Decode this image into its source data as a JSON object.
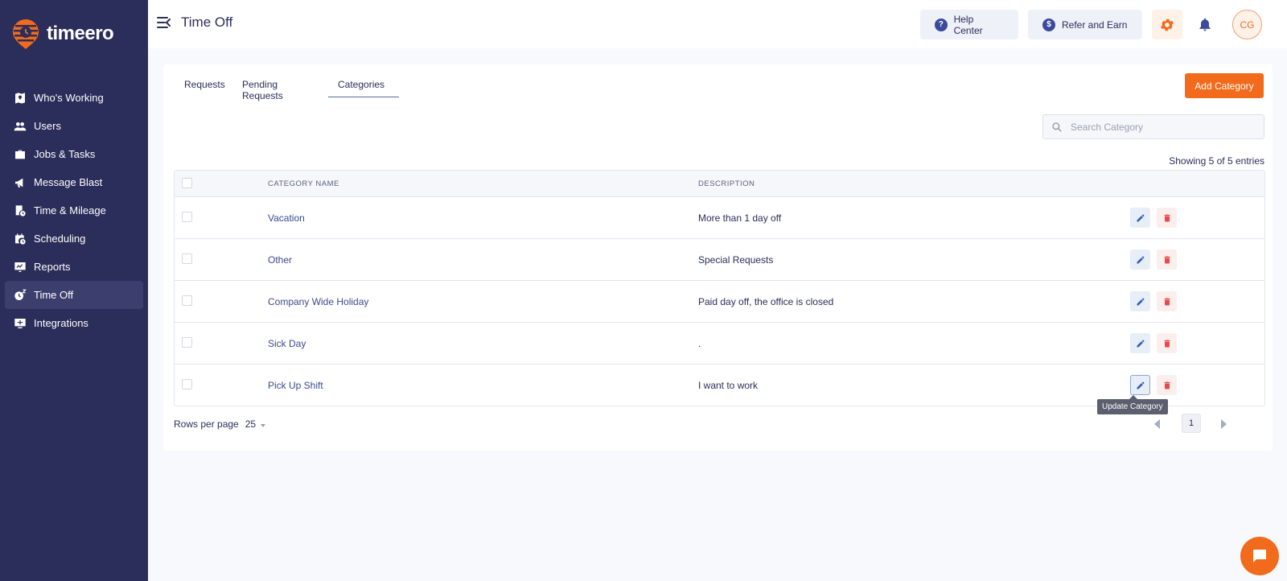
{
  "brand": {
    "name": "timeero",
    "accent": "#f26a1b",
    "sidebar_bg": "#2b2d5a"
  },
  "sidebar": {
    "items": [
      {
        "label": "Who's Working",
        "icon": "map-pin-icon",
        "active": false
      },
      {
        "label": "Users",
        "icon": "users-icon",
        "active": false
      },
      {
        "label": "Jobs & Tasks",
        "icon": "briefcase-icon",
        "active": false
      },
      {
        "label": "Message Blast",
        "icon": "megaphone-icon",
        "active": false
      },
      {
        "label": "Time & Mileage",
        "icon": "timesheet-icon",
        "active": false
      },
      {
        "label": "Scheduling",
        "icon": "calendar-clock-icon",
        "active": false
      },
      {
        "label": "Reports",
        "icon": "report-icon",
        "active": false
      },
      {
        "label": "Time Off",
        "icon": "time-off-icon",
        "active": true
      },
      {
        "label": "Integrations",
        "icon": "integrations-icon",
        "active": false
      }
    ]
  },
  "header": {
    "title": "Time Off",
    "help_label": "Help Center",
    "refer_label": "Refer and Earn",
    "avatar_initials": "CG"
  },
  "tabs": [
    {
      "label": "Requests",
      "active": false
    },
    {
      "label": "Pending Requests",
      "active": false
    },
    {
      "label": "Categories",
      "active": true
    }
  ],
  "add_button_label": "Add Category",
  "search": {
    "placeholder": "Search Category",
    "value": ""
  },
  "showing_text": "Showing 5 of 5 entries",
  "table": {
    "columns": [
      "CATEGORY NAME",
      "DESCRIPTION"
    ],
    "rows": [
      {
        "name": "Vacation",
        "description": "More than 1 day off"
      },
      {
        "name": "Other",
        "description": "Special Requests"
      },
      {
        "name": "Company Wide Holiday",
        "description": "Paid day off, the office is closed"
      },
      {
        "name": "Sick Day",
        "description": "."
      },
      {
        "name": "Pick Up Shift",
        "description": "I want to work"
      }
    ]
  },
  "tooltip_text": "Update Category",
  "pagination": {
    "rows_per_page_label": "Rows per page",
    "rows_per_page": "25",
    "current_page": "1"
  }
}
